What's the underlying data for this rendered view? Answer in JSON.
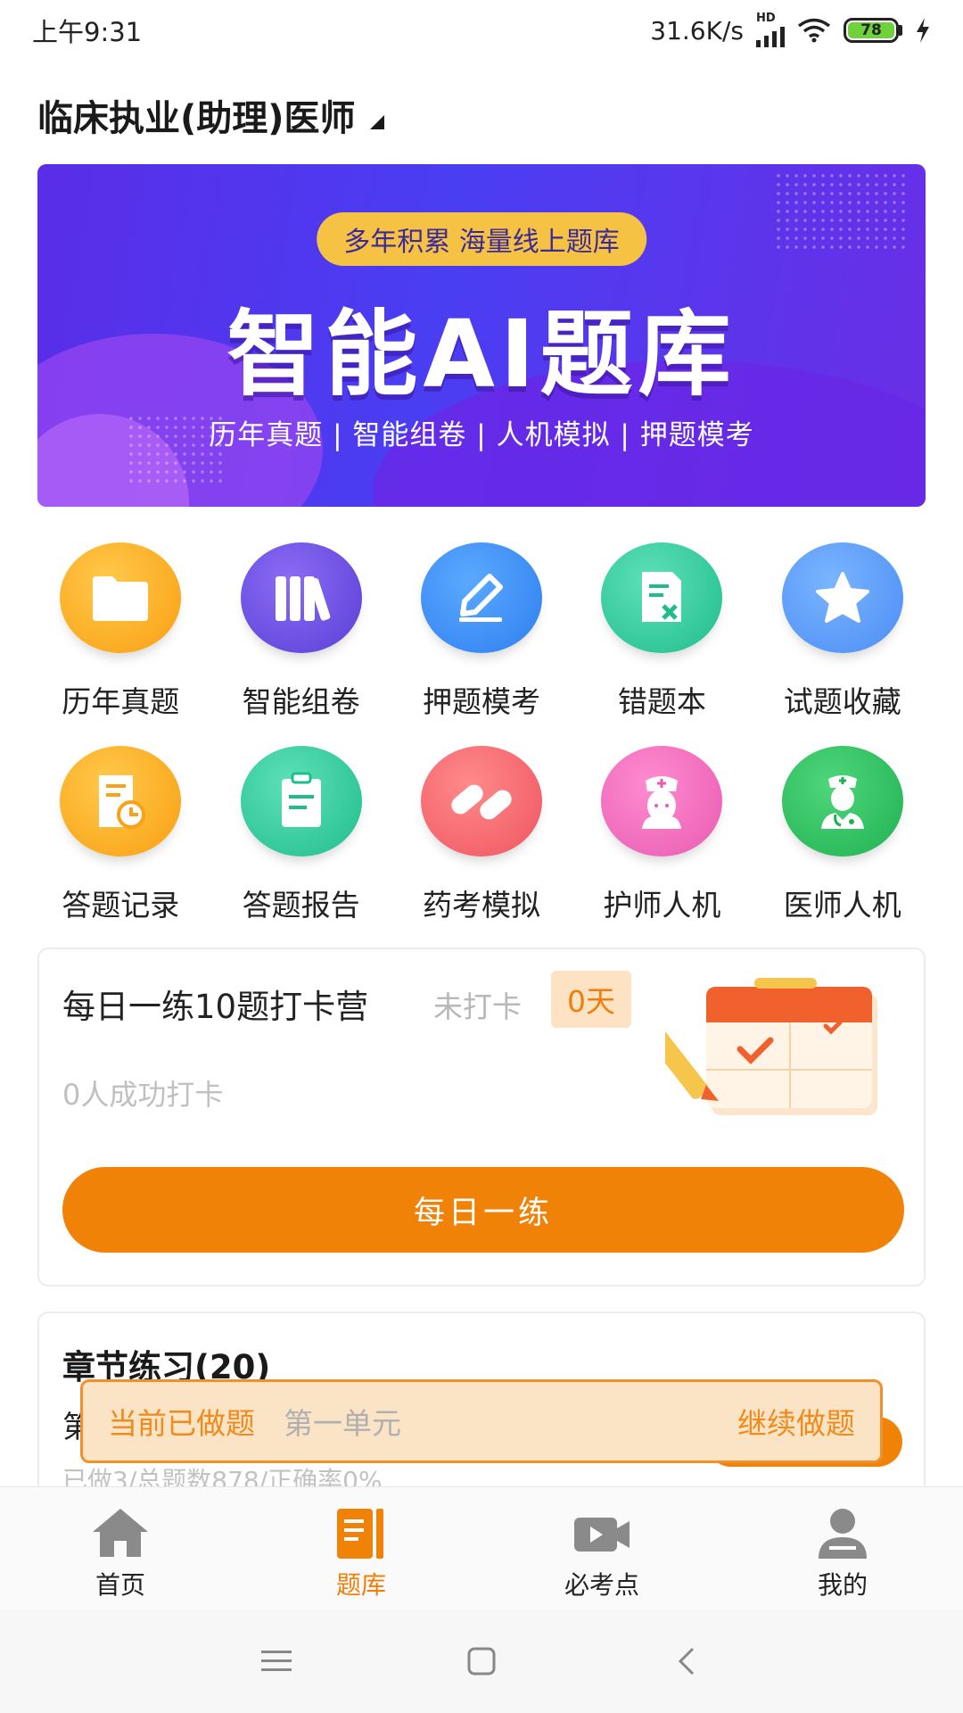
{
  "status_bar": {
    "time": "上午9:31",
    "network_speed": "31.6K/s",
    "network_badge": "HD",
    "battery_level": "78"
  },
  "header": {
    "exam_title": "临床执业(助理)医师"
  },
  "banner": {
    "pill": "多年积累 海量线上题库",
    "title": "智能AI题库",
    "subtitle": "历年真题 | 智能组卷 | 人机模拟 | 押题模考"
  },
  "grid": [
    {
      "label": "历年真题",
      "icon": "folder-icon"
    },
    {
      "label": "智能组卷",
      "icon": "books-icon"
    },
    {
      "label": "押题模考",
      "icon": "pen-icon"
    },
    {
      "label": "错题本",
      "icon": "wrong-doc-icon"
    },
    {
      "label": "试题收藏",
      "icon": "star-icon"
    },
    {
      "label": "答题记录",
      "icon": "record-clock-icon"
    },
    {
      "label": "答题报告",
      "icon": "clipboard-icon"
    },
    {
      "label": "药考模拟",
      "icon": "pill-icon"
    },
    {
      "label": "护师人机",
      "icon": "nurse-icon"
    },
    {
      "label": "医师人机",
      "icon": "doctor-icon"
    }
  ],
  "checkin": {
    "title": "每日一练10题打卡营",
    "status": "未打卡",
    "days": "0天",
    "count_text": "0人成功打卡",
    "button": "每日一练"
  },
  "chapter": {
    "title": "章节练习(20)",
    "first_char": "第",
    "stats": "已做3/总题数878/正确率0%"
  },
  "float_bar": {
    "label": "当前已做题",
    "unit": "第一单元",
    "action": "继续做题"
  },
  "bottom_nav": [
    {
      "label": "首页",
      "icon": "home-icon",
      "active": false
    },
    {
      "label": "题库",
      "icon": "question-bank-icon",
      "active": true
    },
    {
      "label": "必考点",
      "icon": "video-icon",
      "active": false
    },
    {
      "label": "我的",
      "icon": "user-icon",
      "active": false
    }
  ],
  "colors": {
    "accent": "#f08208",
    "banner": "#5a2de8",
    "active_tab": "#ef7f0a"
  }
}
